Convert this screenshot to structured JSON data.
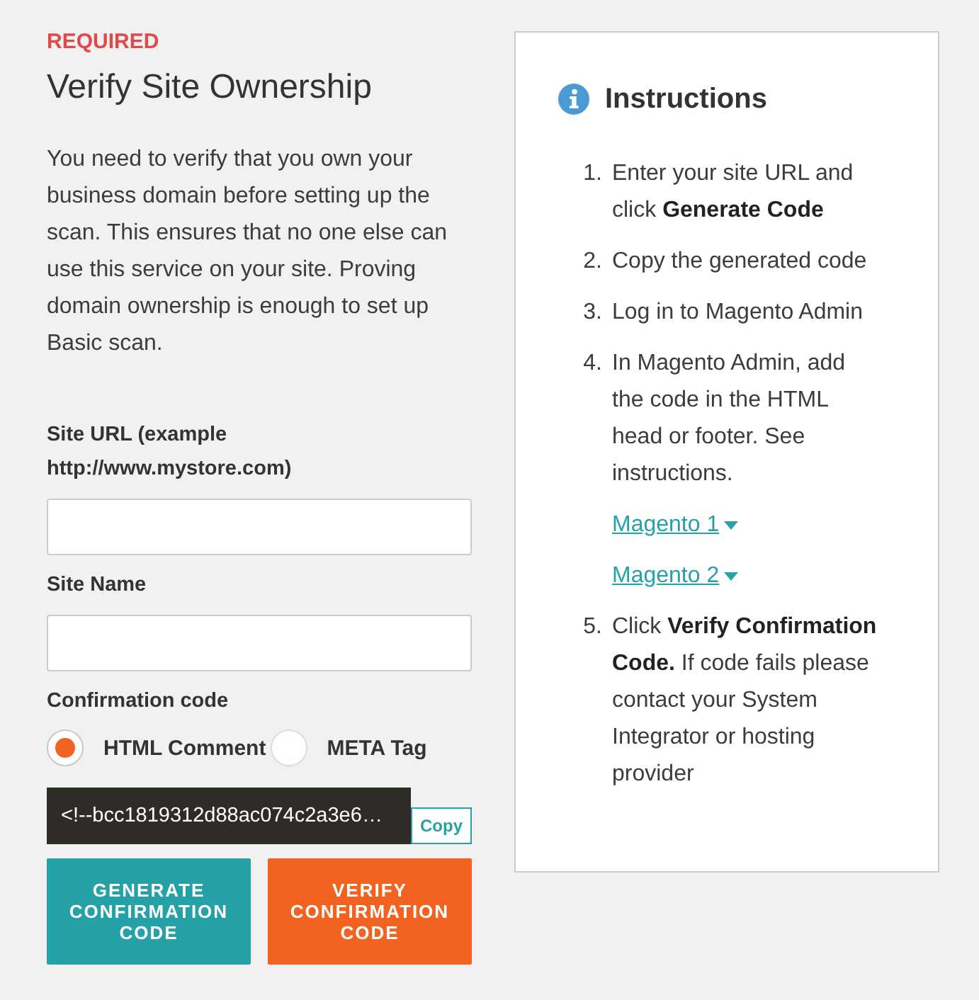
{
  "section": {
    "badge": "REQUIRED",
    "title": "Verify Site Ownership",
    "description": "You need to verify that you own your business domain before setting up the scan. This ensures that no one else can use this service on your site. Proving domain ownership is enough to set up Basic scan."
  },
  "form": {
    "fields": [
      {
        "label": "Site URL (example http://www.mystore.com)"
      },
      {
        "label": "Site Name"
      }
    ],
    "confirmation": {
      "label": "Confirmation code",
      "options": [
        {
          "label": "HTML Comment",
          "selected": true
        },
        {
          "label": "META Tag",
          "selected": false
        }
      ],
      "code": "<!--bcc1819312d88ac074c2a3e6…",
      "copy_button": "Copy"
    },
    "buttons": [
      {
        "label": "GENERATE CONFIRMATION CODE",
        "kind": "secondary"
      },
      {
        "label": "VERIFY CONFIRMATION CODE",
        "kind": "primary"
      }
    ]
  },
  "instructions": {
    "title": "Instructions",
    "steps": [
      {
        "number": "1.",
        "text": "Enter your site URL and click **Generate Code**"
      },
      {
        "number": "2.",
        "text": "Copy the generated code"
      },
      {
        "number": "3.",
        "text": "Log in to Magento Admin"
      },
      {
        "number": "4.",
        "text": "In Magento Admin, add the code in the HTML head or footer. See instructions.",
        "links": [
          "Magento 1",
          "Magento 2"
        ]
      },
      {
        "number": "5.",
        "text": "Click **Verify Confirmation Code.** If code fails please contact your System Integrator or hosting provider"
      }
    ]
  }
}
